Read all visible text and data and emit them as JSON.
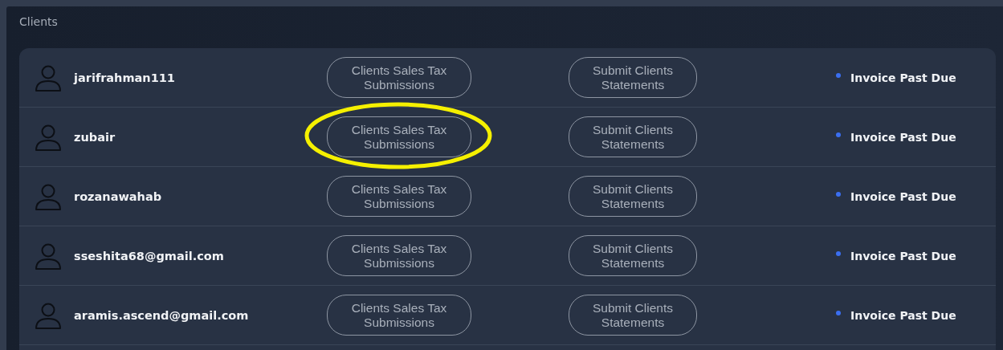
{
  "section": {
    "title": "Clients"
  },
  "clients": [
    {
      "name": "jarifrahman111",
      "tax_button": "Clients Sales Tax Submissions",
      "statements_button": "Submit Clients Statements",
      "status": "Invoice Past Due",
      "color": "#3b6ef0",
      "highlighted": false
    },
    {
      "name": "zubair",
      "tax_button": "Clients Sales Tax Submissions",
      "statements_button": "Submit Clients Statements",
      "status": "Invoice Past Due",
      "color": "#3b6ef0",
      "highlighted": true
    },
    {
      "name": "rozanawahab",
      "tax_button": "Clients Sales Tax Submissions",
      "statements_button": "Submit Clients Statements",
      "status": "Invoice Past Due",
      "color": "#3b6ef0",
      "highlighted": false
    },
    {
      "name": "sseshita68@gmail.com",
      "tax_button": "Clients Sales Tax Submissions",
      "statements_button": "Submit Clients Statements",
      "status": "Invoice Past Due",
      "color": "#3b6ef0",
      "highlighted": false
    },
    {
      "name": "aramis.ascend@gmail.com",
      "tax_button": "Clients Sales Tax Submissions",
      "statements_button": "Submit Clients Statements",
      "status": "Invoice Past Due",
      "color": "#3b6ef0",
      "highlighted": false
    }
  ]
}
